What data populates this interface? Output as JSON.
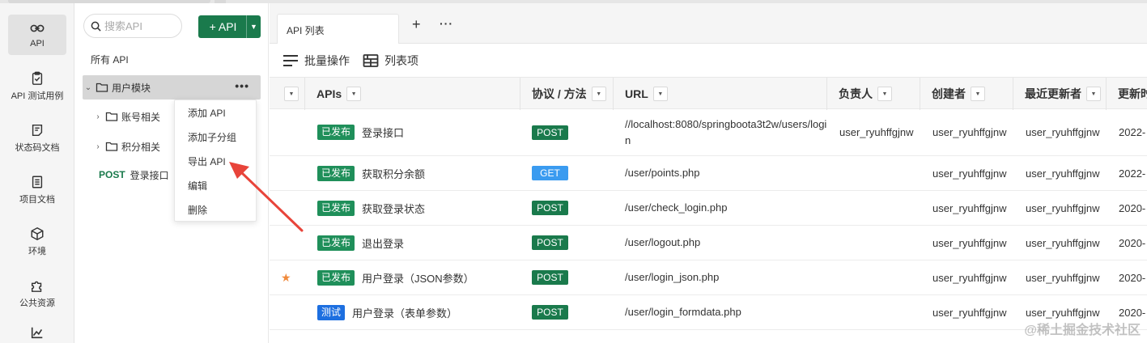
{
  "colors": {
    "brand_green": "#1a7a4c",
    "published_badge": "#1f8f5a",
    "test_badge": "#1d6fe0",
    "get_method": "#3a9bf0",
    "post_method": "#1a7a4c",
    "star": "#f08a3c"
  },
  "rail": {
    "items": [
      {
        "label": "API",
        "icon": "link-icon",
        "active": true
      },
      {
        "label": "API 测试用例",
        "icon": "clipboard-check-icon"
      },
      {
        "label": "状态码文档",
        "icon": "doc-icon"
      },
      {
        "label": "项目文档",
        "icon": "book-icon"
      },
      {
        "label": "环境",
        "icon": "cube-icon"
      },
      {
        "label": "公共资源",
        "icon": "puzzle-icon"
      }
    ]
  },
  "tree": {
    "search_placeholder": "搜索API",
    "add_button_label": "+ API",
    "all_label": "所有 API",
    "groups": [
      {
        "label": "用户模块",
        "expanded": true
      },
      {
        "label": "账号相关"
      },
      {
        "label": "积分相关"
      }
    ],
    "post_item": {
      "method": "POST",
      "label": "登录接口"
    }
  },
  "context_menu": {
    "items": [
      "添加 API",
      "添加子分组",
      "导出 API",
      "编辑",
      "删除"
    ]
  },
  "tabs": {
    "active_label": "API 列表",
    "plus": "+",
    "more": "···"
  },
  "toolbar": {
    "batch_label": "批量操作",
    "columns_label": "列表项"
  },
  "table": {
    "headers": [
      "APIs",
      "协议 / 方法",
      "URL",
      "负责人",
      "创建者",
      "最近更新者",
      "更新时"
    ],
    "rows": [
      {
        "starred": false,
        "status": "已发布",
        "status_type": "published",
        "name": "登录接口",
        "method": "POST",
        "url": "//localhost:8080/springboota3t2w/users/login",
        "owner": "user_ryuhffgjnw",
        "creator": "user_ryuhffgjnw",
        "updater": "user_ryuhffgjnw",
        "updated": "2022-"
      },
      {
        "starred": false,
        "status": "已发布",
        "status_type": "published",
        "name": "获取积分余额",
        "method": "GET",
        "url": "/user/points.php",
        "owner": "",
        "creator": "user_ryuhffgjnw",
        "updater": "user_ryuhffgjnw",
        "updated": "2022-"
      },
      {
        "starred": false,
        "status": "已发布",
        "status_type": "published",
        "name": "获取登录状态",
        "method": "POST",
        "url": "/user/check_login.php",
        "owner": "",
        "creator": "user_ryuhffgjnw",
        "updater": "user_ryuhffgjnw",
        "updated": "2020-"
      },
      {
        "starred": false,
        "status": "已发布",
        "status_type": "published",
        "name": "退出登录",
        "method": "POST",
        "url": "/user/logout.php",
        "owner": "",
        "creator": "user_ryuhffgjnw",
        "updater": "user_ryuhffgjnw",
        "updated": "2020-"
      },
      {
        "starred": true,
        "status": "已发布",
        "status_type": "published",
        "name": "用户登录（JSON参数）",
        "method": "POST",
        "url": "/user/login_json.php",
        "owner": "",
        "creator": "user_ryuhffgjnw",
        "updater": "user_ryuhffgjnw",
        "updated": "2020-"
      },
      {
        "starred": false,
        "status": "测试",
        "status_type": "test",
        "name": "用户登录（表单参数）",
        "method": "POST",
        "url": "/user/login_formdata.php",
        "owner": "",
        "creator": "user_ryuhffgjnw",
        "updater": "user_ryuhffgjnw",
        "updated": "2020-"
      }
    ]
  },
  "watermark": "@稀土掘金技术社区"
}
